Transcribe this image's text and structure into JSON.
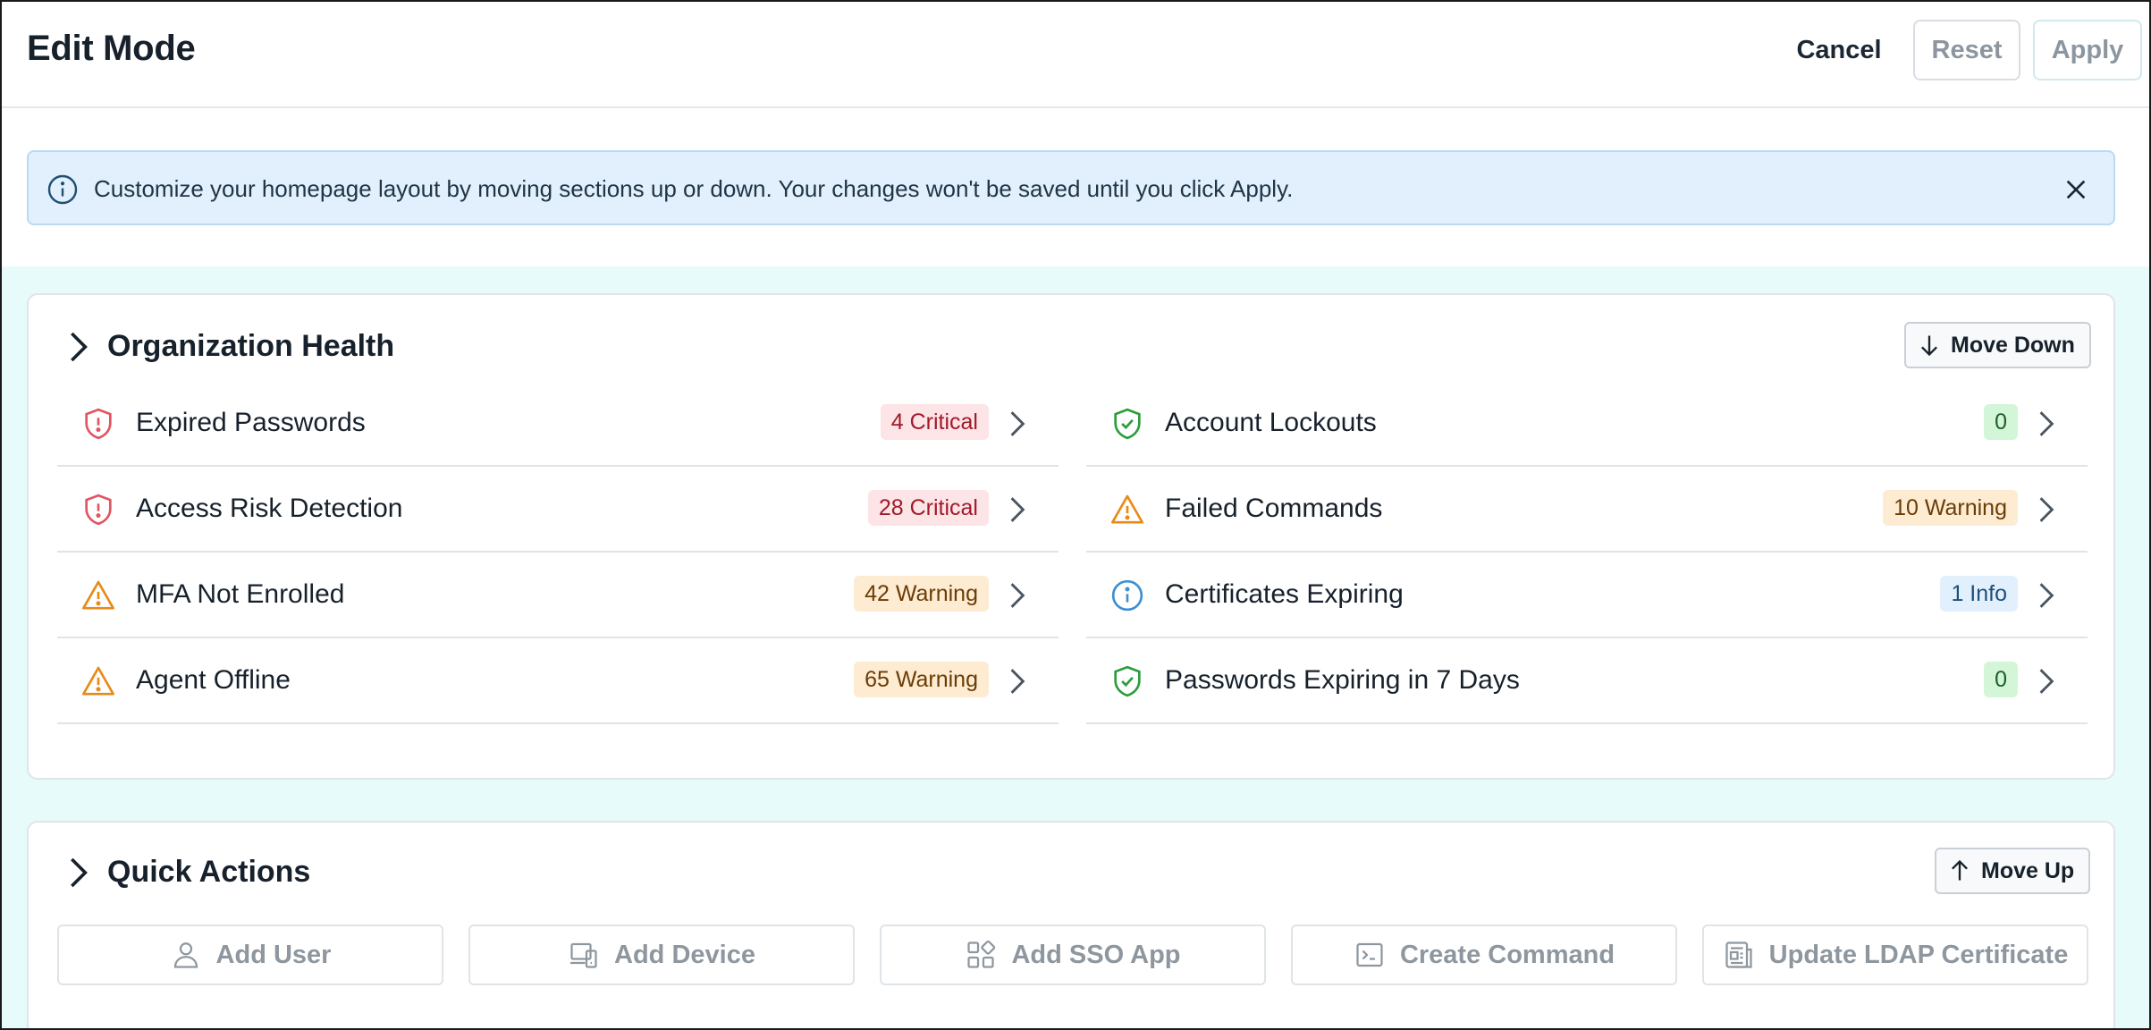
{
  "header": {
    "title": "Edit Mode",
    "cancel_label": "Cancel",
    "reset_label": "Reset",
    "apply_label": "Apply"
  },
  "banner": {
    "text": "Customize your homepage layout by moving sections up or down. Your changes won't be saved until you click Apply.",
    "icon": "info-icon"
  },
  "colors": {
    "edit_area_bg": "#e6fbfa",
    "banner_bg": "#e1f0fc",
    "critical_bg": "#fde4e6",
    "critical_fg": "#a11a2a",
    "warning_bg": "#fdebd2",
    "warning_fg": "#6b3d06",
    "info_bg": "#e1f0fc",
    "info_fg": "#1f4e79",
    "ok_bg": "#d3f5d8",
    "ok_fg": "#1d5e2a"
  },
  "health": {
    "title": "Organization Health",
    "move_label": "Move Down",
    "left_rows": [
      {
        "label": "Expired Passwords",
        "badge": "4 Critical",
        "status": "critical",
        "icon": "shield-alert-icon"
      },
      {
        "label": "Access Risk Detection",
        "badge": "28 Critical",
        "status": "critical",
        "icon": "shield-alert-icon"
      },
      {
        "label": "MFA Not Enrolled",
        "badge": "42 Warning",
        "status": "warning",
        "icon": "warning-triangle-icon"
      },
      {
        "label": "Agent Offline",
        "badge": "65 Warning",
        "status": "warning",
        "icon": "warning-triangle-icon"
      }
    ],
    "right_rows": [
      {
        "label": "Account Lockouts",
        "badge": "0",
        "status": "ok",
        "icon": "shield-check-icon"
      },
      {
        "label": "Failed Commands",
        "badge": "10 Warning",
        "status": "warning",
        "icon": "warning-triangle-icon"
      },
      {
        "label": "Certificates Expiring",
        "badge": "1 Info",
        "status": "info",
        "icon": "info-circle-icon"
      },
      {
        "label": "Passwords Expiring in 7 Days",
        "badge": "0",
        "status": "ok",
        "icon": "shield-check-icon"
      }
    ]
  },
  "quick_actions": {
    "title": "Quick Actions",
    "move_label": "Move Up",
    "buttons": [
      {
        "label": "Add User",
        "icon": "user-icon"
      },
      {
        "label": "Add Device",
        "icon": "device-icon"
      },
      {
        "label": "Add SSO App",
        "icon": "apps-grid-icon"
      },
      {
        "label": "Create Command",
        "icon": "terminal-icon"
      },
      {
        "label": "Update LDAP Certificate",
        "icon": "certificate-icon"
      }
    ]
  }
}
